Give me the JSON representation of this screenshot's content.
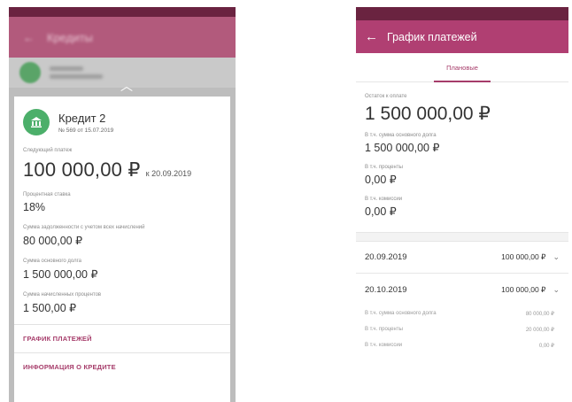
{
  "left": {
    "appbar": {
      "back_icon": "arrow-left-icon",
      "title": "Кредиты"
    },
    "drag_icon": "chevron-down-icon",
    "loan": {
      "avatar_icon": "bank-icon",
      "avatar_text": "🏛",
      "name": "Кредит 2",
      "subtitle": "№ 569 от 15.07.2019"
    },
    "next_payment": {
      "label": "Следующий платеж",
      "amount": "100 000,00 ₽",
      "due": "к 20.09.2019"
    },
    "fields": [
      {
        "label": "Процентная ставка",
        "value": "18%"
      },
      {
        "label": "Сумма задолженности с учетом всех начислений",
        "value": "80 000,00 ₽"
      },
      {
        "label": "Сумма основного долга",
        "value": "1 500 000,00 ₽"
      },
      {
        "label": "Сумма начисленных процентов",
        "value": "1 500,00 ₽"
      }
    ],
    "links": {
      "schedule": "ГРАФИК ПЛАТЕЖЕЙ",
      "info": "ИНФОРМАЦИЯ О КРЕДИТЕ"
    }
  },
  "right": {
    "appbar": {
      "back_icon": "arrow-left-icon",
      "title": "График платежей"
    },
    "tab": "Плановые",
    "summary": {
      "total_label": "Остаток к оплате",
      "total_value": "1 500 000,00 ₽",
      "principal_label": "В т.ч. сумма основного долга",
      "principal_value": "1 500 000,00 ₽",
      "interest_label": "В т.ч. проценты",
      "interest_value": "0,00 ₽",
      "fees_label": "В т.ч. комиссии",
      "fees_value": "0,00 ₽"
    },
    "payments": [
      {
        "date": "20.09.2019",
        "amount": "100 000,00 ₽"
      },
      {
        "date": "20.10.2019",
        "amount": "100 000,00 ₽"
      }
    ],
    "expand_icon": "chevron-down-icon",
    "details": [
      {
        "label": "В т.ч. сумма основного долга",
        "value": "80 000,00 ₽"
      },
      {
        "label": "В т.ч. проценты",
        "value": "20 000,00 ₽"
      },
      {
        "label": "В т.ч. комиссии",
        "value": "0,00 ₽"
      }
    ]
  }
}
